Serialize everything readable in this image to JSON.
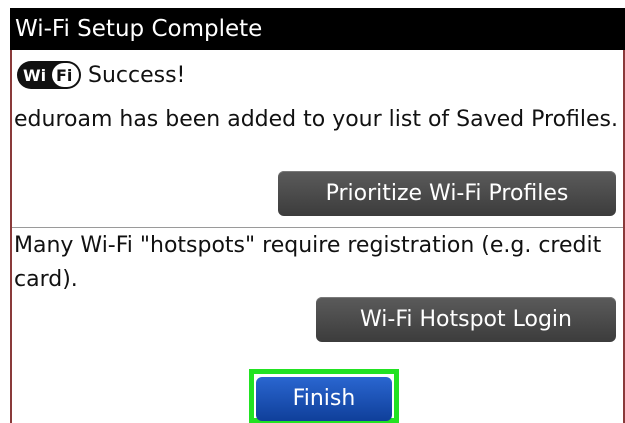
{
  "dialog": {
    "title": "Wi-Fi Setup Complete"
  },
  "status": {
    "icon": "wifi-icon",
    "icon_text": "WiFi",
    "text": "Success!"
  },
  "message": {
    "text": "eduroam has been added to your list of Saved Profiles."
  },
  "buttons": {
    "prioritize_label": "Prioritize Wi-Fi Profiles",
    "hotspot_label": "Wi-Fi Hotspot Login",
    "finish_label": "Finish"
  },
  "hotspot": {
    "text": "Many Wi-Fi \"hotspots\" require registration (e.g. credit card)."
  },
  "colors": {
    "title_bar": "#000000",
    "frame": "#8a3a3a",
    "dark_button": "#4a4a4a",
    "finish_button": "#1d51b5",
    "focus_highlight": "#22e222"
  }
}
